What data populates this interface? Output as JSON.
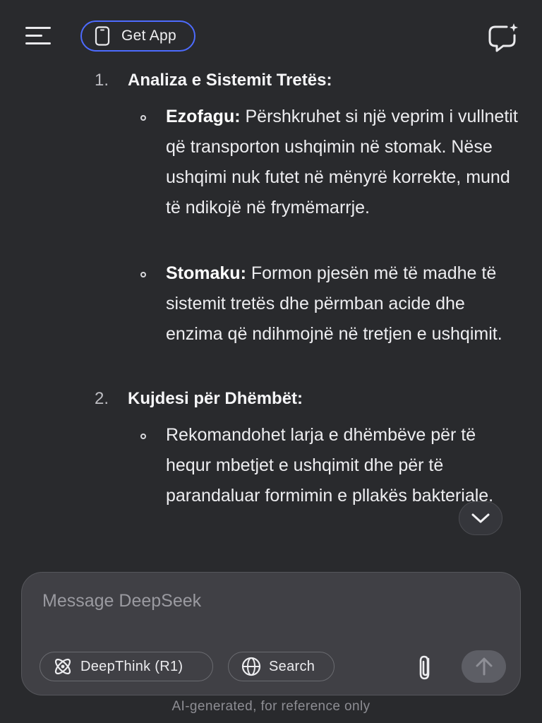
{
  "header": {
    "menu_icon": "hamburger-menu-icon",
    "get_app_label": "Get App",
    "get_app_icon": "phone-icon",
    "new_chat_icon": "new-chat-icon",
    "accent_color": "#4d6bfe"
  },
  "content": {
    "sections": [
      {
        "number": "1.",
        "title": "Analiza e Sistemit Tretës:",
        "bullets": [
          {
            "bold": "Ezofagu:",
            "text": " Përshkruhet si një veprim i vullnetit që transporton ushqimin në stomak. Nëse ushqimi nuk futet në mënyrë korrekte, mund të ndikojë në frymëmarrje."
          },
          {
            "bold": "Stomaku:",
            "text": " Formon pjesën më të madhe të sistemit tretës dhe përmban acide dhe enzima që ndihmojnë në tretjen e ushqimit."
          }
        ]
      },
      {
        "number": "2.",
        "title": "Kujdesi për Dhëmbët:",
        "bullets": [
          {
            "bold": "",
            "text": "Rekomandohet larja e dhëmbëve për të hequr mbetjet e ushqimit dhe për të parandaluar formimin e pllakës bakteriale."
          }
        ]
      }
    ],
    "scroll_down_icon": "chevron-down-icon"
  },
  "composer": {
    "placeholder": "Message DeepSeek",
    "deepthink_label": "DeepThink (R1)",
    "deepthink_icon": "atom-icon",
    "search_label": "Search",
    "search_icon": "globe-icon",
    "attach_icon": "paperclip-icon",
    "send_icon": "arrow-up-icon"
  },
  "footer": {
    "note": "AI-generated, for reference only"
  }
}
